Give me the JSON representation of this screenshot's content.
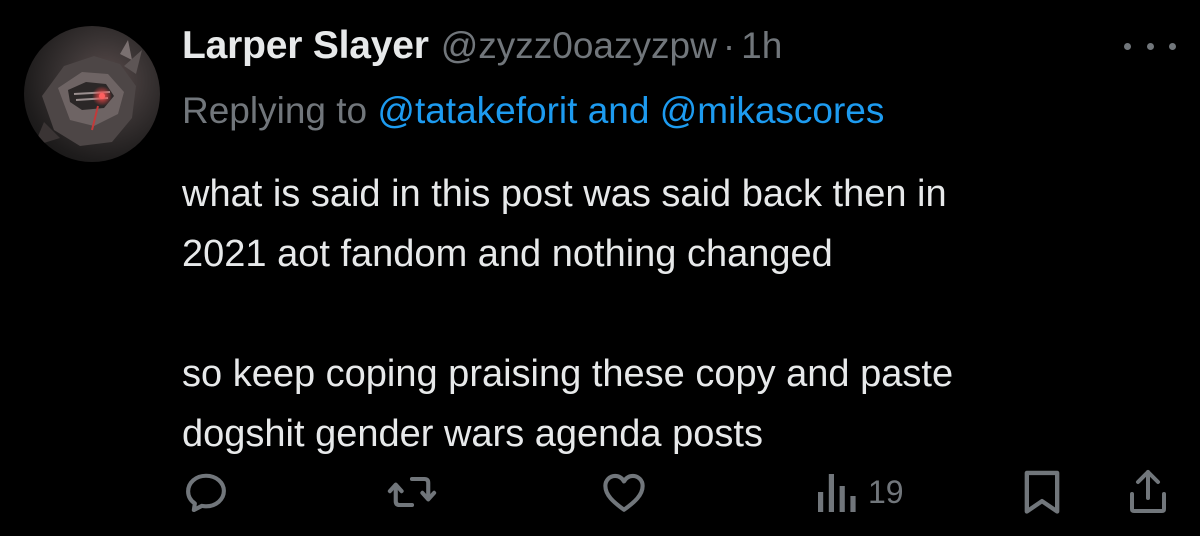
{
  "tweet": {
    "display_name": "Larper Slayer",
    "handle": "@zyzz0oazyzpw",
    "separator": "·",
    "time": "1h",
    "reply_prefix": "Replying to ",
    "reply_mention_1": "@tatakeforit",
    "reply_joiner": " and ",
    "reply_mention_2": "@mikascores",
    "text_line_1": "what is said in this post was said back then in",
    "text_line_2": "2021 aot fandom and nothing changed",
    "text_line_3": "so keep coping praising these copy and paste",
    "text_line_4": "dogshit gender wars agenda posts"
  },
  "actions": {
    "views_count": "19"
  },
  "icons": {
    "avatar": "avatar",
    "more": "more-dots-icon",
    "reply": "reply-icon",
    "retweet": "retweet-icon",
    "like": "heart-icon",
    "views": "views-chart-icon",
    "bookmark": "bookmark-icon",
    "share": "share-icon"
  },
  "colors": {
    "background": "#000000",
    "text_primary": "#e7e9ea",
    "text_secondary": "#71767b",
    "link": "#1d9bf0"
  }
}
